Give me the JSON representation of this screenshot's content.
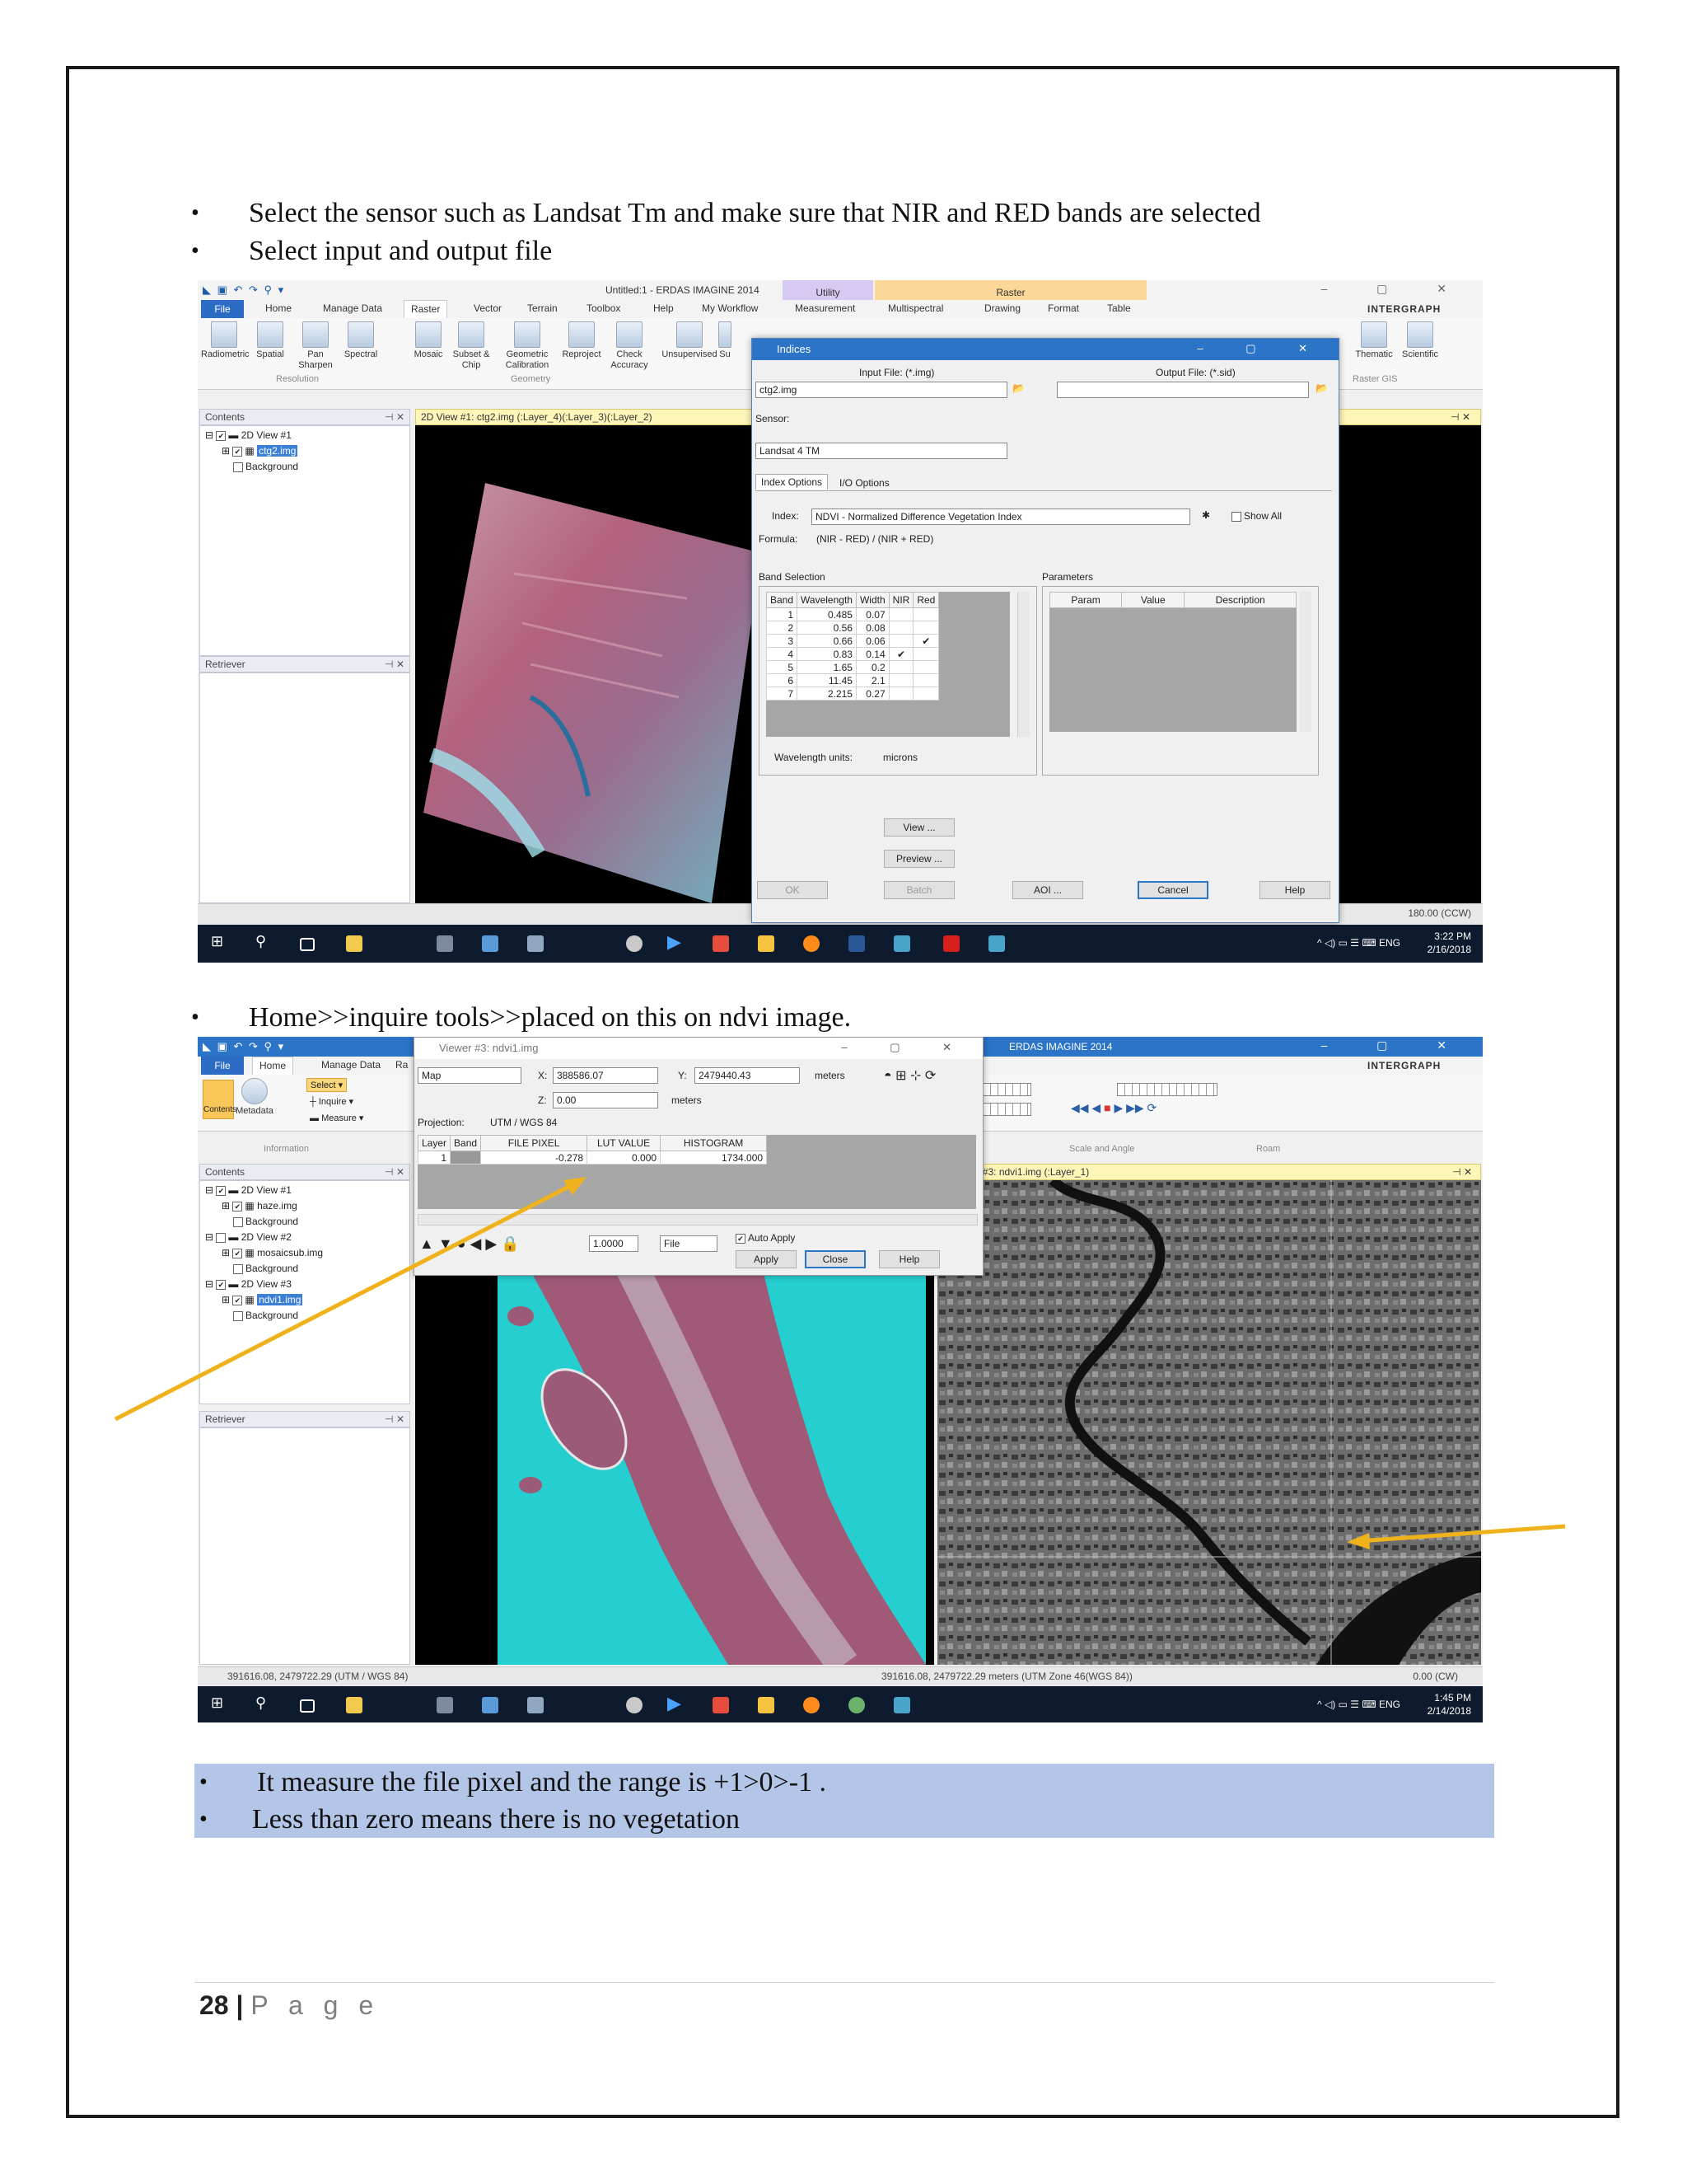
{
  "bullets_top": [
    "Select the sensor such as Landsat Tm and make sure that NIR and RED bands are selected",
    "Select input and output file"
  ],
  "bullet_mid": "Home>>inquire tools>>placed on this on ndvi image.",
  "bullets_bottom": [
    "It measure the file pixel and the range is +1>0>-1 .",
    "Less than zero  means there is no vegetation"
  ],
  "footer": {
    "page_number": "28",
    "separator": "|",
    "page_label": "P a g e"
  },
  "shot1": {
    "window_title": "Untitled:1 - ERDAS IMAGINE 2014",
    "context_tabs": {
      "utility": "Utility",
      "raster": "Raster"
    },
    "tabs": [
      "File",
      "Home",
      "Manage Data",
      "Raster",
      "Vector",
      "Terrain",
      "Toolbox",
      "Help",
      "My Workflow",
      "Measurement",
      "Multispectral",
      "Drawing",
      "Format",
      "Table"
    ],
    "brand": "INTERGRAPH",
    "ribbon": [
      "Radiometric",
      "Spatial",
      "Pan Sharpen",
      "Spectral",
      "Mosaic",
      "Subset & Chip",
      "Geometric Calibration",
      "Reproject",
      "Check Accuracy",
      "Unsupervised",
      "Su",
      "Thematic",
      "Scientific"
    ],
    "ribbon_groups": [
      "Resolution",
      "Geometry",
      "Raster GIS"
    ],
    "contents_title": "Contents",
    "retriever_title": "Retriever",
    "tree": [
      "2D View #1",
      "ctg2.img",
      "Background"
    ],
    "view_title": "2D View #1: ctg2.img (:Layer_4)(:Layer_3)(:Layer_2)",
    "status_right": "180.00 (CCW)",
    "clock": {
      "time": "3:22 PM",
      "date": "2/16/2018"
    },
    "tray": "ENG",
    "dialog": {
      "title": "Indices",
      "input_label": "Input File: (*.img)",
      "output_label": "Output File: (*.sid)",
      "input_value": "ctg2.img",
      "sensor_label": "Sensor:",
      "sensor_value": "Landsat 4 TM",
      "tab_index": "Index Options",
      "tab_io": "I/O Options",
      "index_label": "Index:",
      "index_value": "NDVI - Normalized Difference Vegetation Index",
      "show_all": "Show All",
      "formula_label": "Formula:",
      "formula_value": "(NIR - RED) / (NIR + RED)",
      "band_selection": "Band Selection",
      "parameters": "Parameters",
      "band_headers": [
        "Band",
        "Wavelength",
        "Width",
        "NIR",
        "Red"
      ],
      "bands": [
        [
          "1",
          "0.485",
          "0.07",
          "",
          ""
        ],
        [
          "2",
          "0.56",
          "0.08",
          "",
          ""
        ],
        [
          "3",
          "0.66",
          "0.06",
          "",
          "✔"
        ],
        [
          "4",
          "0.83",
          "0.14",
          "✔",
          ""
        ],
        [
          "5",
          "1.65",
          "0.2",
          "",
          ""
        ],
        [
          "6",
          "11.45",
          "2.1",
          "",
          ""
        ],
        [
          "7",
          "2.215",
          "0.27",
          "",
          ""
        ]
      ],
      "param_headers": [
        "Param",
        "Value",
        "Description"
      ],
      "wavelength_units_label": "Wavelength units:",
      "wavelength_units_value": "microns",
      "view_btn": "View ...",
      "preview_btn": "Preview ...",
      "ok_btn": "OK",
      "batch_btn": "Batch",
      "aoi_btn": "AOI ...",
      "cancel_btn": "Cancel",
      "help_btn": "Help"
    }
  },
  "shot2": {
    "window_title": "ERDAS IMAGINE 2014",
    "tabs": [
      "File",
      "Home",
      "Manage Data",
      "Ra"
    ],
    "brand": "INTERGRAPH",
    "ribbon": [
      "Select",
      "Inquire",
      "Measure",
      "Contents",
      "Metadata"
    ],
    "ribbon_groups": [
      "Information",
      "Scale and Angle",
      "Roam"
    ],
    "contents_title": "Contents",
    "retriever_title": "Retriever",
    "tree": [
      "2D View #1",
      "haze.img",
      "Background",
      "2D View #2",
      "mosaicsub.img",
      "Background",
      "2D View #3",
      "ndvi1.img",
      "Background"
    ],
    "view_title": "2D View #3: ndvi1.img (:Layer_1)",
    "status_left": "391616.08, 2479722.29  (UTM / WGS 84)",
    "status_mid": "391616.08, 2479722.29 meters (UTM Zone 46(WGS 84))",
    "status_right": "0.00 (CW)",
    "clock": {
      "time": "1:45 PM",
      "date": "2/14/2018"
    },
    "tray": "ENG",
    "viewer": {
      "title": "Viewer #3:  ndvi1.img",
      "coord_type": "Map",
      "x_label": "X:",
      "x_value": "388586.07",
      "y_label": "Y:",
      "y_value": "2479440.43",
      "units": "meters",
      "z_label": "Z:",
      "z_value": "0.00",
      "z_units": "meters",
      "projection_label": "Projection:",
      "projection_value": "UTM / WGS 84",
      "headers": [
        "Layer",
        "Band",
        "FILE PIXEL",
        "LUT VALUE",
        "HISTOGRAM"
      ],
      "row": [
        "1",
        "",
        "-0.278",
        "0.000",
        "1734.000"
      ],
      "step_value": "1.0000",
      "file_option": "File",
      "auto_apply": "Auto Apply",
      "apply_btn": "Apply",
      "close_btn": "Close",
      "help_btn": "Help"
    }
  },
  "colors": {
    "highlight": "#b4c6e7",
    "arrow": "#f0b21a",
    "dialog_title": "#2b74c8",
    "view_header": "#fef5b9",
    "taskbar": "#0e1b2e"
  }
}
